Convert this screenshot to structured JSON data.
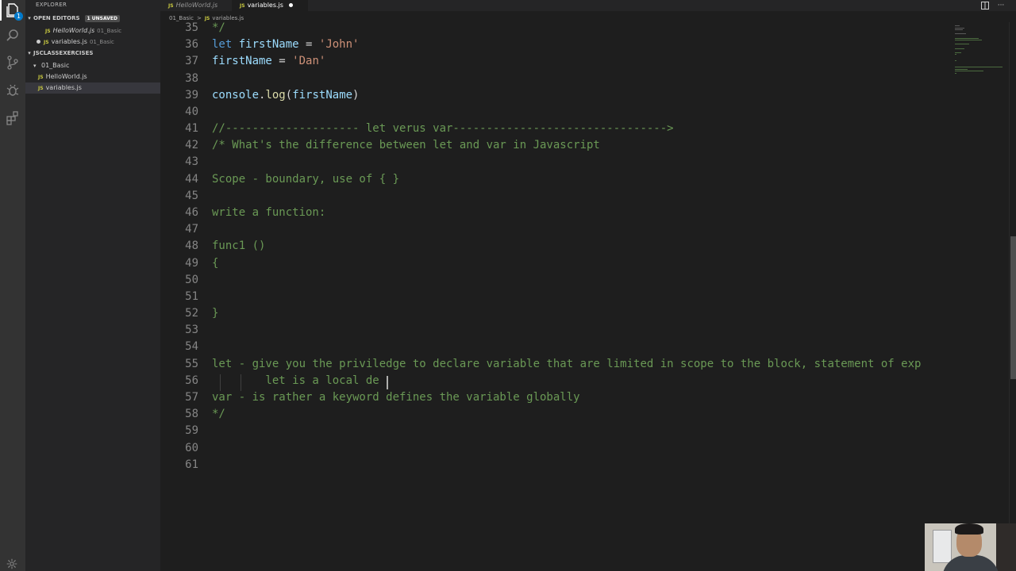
{
  "sidebar": {
    "title": "EXPLORER",
    "open_editors": {
      "label": "OPEN EDITORS",
      "badge": "1 UNSAVED"
    },
    "open_files": [
      {
        "name": "HelloWorld.js",
        "folder": "01_Basic"
      },
      {
        "name": "variables.js",
        "folder": "01_Basic"
      }
    ],
    "workspace": {
      "label": "JSCLASSEXERCISES"
    },
    "folder": {
      "name": "01_Basic"
    },
    "files": [
      {
        "name": "HelloWorld.js"
      },
      {
        "name": "variables.js"
      }
    ],
    "file_badge": "JS"
  },
  "tabs": [
    {
      "label": "HelloWorld.js",
      "badge": "JS"
    },
    {
      "label": "variables.js",
      "badge": "JS"
    }
  ],
  "breadcrumb": {
    "folder": "01_Basic",
    "sep": ">",
    "badge": "JS",
    "file": "variables.js"
  },
  "activity": {
    "explorer_badge": "1"
  },
  "editor": {
    "lines": [
      {
        "n": "35",
        "t": "*/"
      },
      {
        "n": "36",
        "t": "let firstName = 'John'"
      },
      {
        "n": "37",
        "t": "firstName = 'Dan'"
      },
      {
        "n": "38",
        "t": ""
      },
      {
        "n": "39",
        "t": "console.log(firstName)"
      },
      {
        "n": "40",
        "t": ""
      },
      {
        "n": "41",
        "t": "//-------------------- let verus var-------------------------------->"
      },
      {
        "n": "42",
        "t": "/* What's the difference between let and var in Javascript"
      },
      {
        "n": "43",
        "t": ""
      },
      {
        "n": "44",
        "t": "Scope - boundary, use of { }"
      },
      {
        "n": "45",
        "t": ""
      },
      {
        "n": "46",
        "t": "write a function:"
      },
      {
        "n": "47",
        "t": ""
      },
      {
        "n": "48",
        "t": "func1 ()"
      },
      {
        "n": "49",
        "t": "{"
      },
      {
        "n": "50",
        "t": ""
      },
      {
        "n": "51",
        "t": ""
      },
      {
        "n": "52",
        "t": "}"
      },
      {
        "n": "53",
        "t": ""
      },
      {
        "n": "54",
        "t": ""
      },
      {
        "n": "55",
        "t": "let - give you the priviledge to declare variable that are limited in scope to the block, statement of exp"
      },
      {
        "n": "56",
        "t": "        let is a local de"
      },
      {
        "n": "57",
        "t": "var - is rather a keyword defines the variable globally"
      },
      {
        "n": "58",
        "t": "*/"
      },
      {
        "n": "59",
        "t": ""
      },
      {
        "n": "60",
        "t": ""
      },
      {
        "n": "61",
        "t": ""
      }
    ]
  },
  "colors": {
    "accent": "#007acc",
    "background": "#1e1e1e",
    "sidebar": "#252526",
    "comment": "#6a9955"
  }
}
